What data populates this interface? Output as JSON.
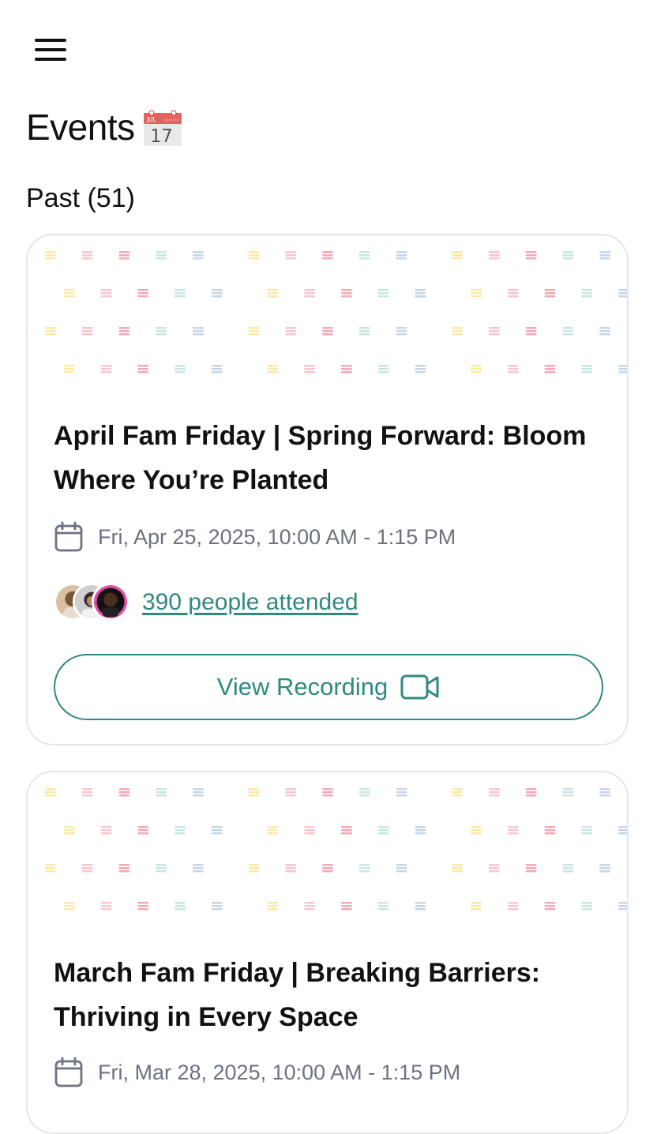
{
  "header": {
    "menu_icon": "hamburger-menu-icon"
  },
  "page": {
    "title": "Events",
    "title_emoji": "calendar-icon",
    "emoji_month": "JUL",
    "emoji_day": "17"
  },
  "section": {
    "label": "Past (51)"
  },
  "colors": {
    "accent": "#2f8a80",
    "date_text": "#6b7280",
    "card_border": "#e6e6e6"
  },
  "events": [
    {
      "title": "April Fam Friday | Spring Forward: Bloom Where You’re Planted",
      "date": "Fri, Apr 25, 2025, 10:00 AM - 1:15 PM",
      "attendees": "390 people attended",
      "button": "View Recording"
    },
    {
      "title": "March Fam Friday | Breaking Barriers: Thriving in Every Space",
      "date": "Fri, Mar 28, 2025, 10:00 AM - 1:15 PM"
    }
  ]
}
